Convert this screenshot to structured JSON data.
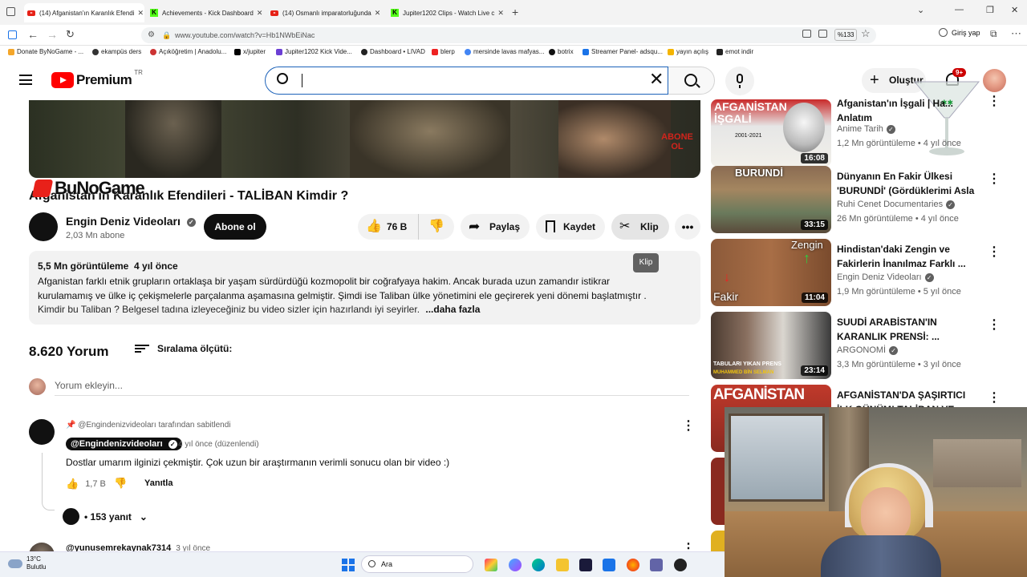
{
  "browser": {
    "tabs": [
      {
        "label": "(14) Afganistan'ın Karanlık Efendi",
        "favicon": "youtube",
        "active": true
      },
      {
        "label": "Achievements - Kick Dashboard",
        "favicon": "kick",
        "active": false
      },
      {
        "label": "(14) Osmanlı imparatorluğunda",
        "favicon": "youtube",
        "active": false
      },
      {
        "label": "Jupiter1202 Clips - Watch Live c",
        "favicon": "kick",
        "active": false
      }
    ],
    "url": "www.youtube.com/watch?v=Hb1NWbEiNac",
    "zoom": "%133",
    "signin_label": "Giriş yap",
    "bookmarks": [
      "Donate ByNoGame - ...",
      "ekampüs ders",
      "Açıköğretim | Anadolu...",
      "x/jupiter",
      "Jupiter1202 Kick Vide...",
      "Dashboard • LIVAD",
      "blerp",
      "mersinde lavas mafyas...",
      "botrix",
      "Streamer Panel- adsqu...",
      "yayın açılış",
      "emot indir"
    ]
  },
  "youtube": {
    "logo_text": "Premium",
    "logo_region": "TR",
    "search_value": "",
    "create_label": "Oluştur",
    "notif_count": "9+"
  },
  "video": {
    "overlay_text": "ABONE OL",
    "watermark": "BuNoGame",
    "title": "Afganistan'ın Karanlık Efendileri - TALİBAN Kimdir ?",
    "channel": "Engin Deniz Videoları",
    "subscribers": "2,03 Mn abone",
    "subscribe_label": "Abone ol",
    "likes": "76 B",
    "share_label": "Paylaş",
    "save_label": "Kaydet",
    "clip_label": "Klip",
    "clip_tooltip": "Klip"
  },
  "description": {
    "meta": "5,5 Mn görüntüleme  4 yıl önce",
    "line1": "Afganistan farklı etnik grupların ortaklaşa bir yaşam sürdürdüğü kozmopolit bir coğrafyaya hakim. Ancak burada uzun zamandır istikrar",
    "line2": "kurulamamış ve ülke iç çekişmelerle parçalanma aşamasına gelmiştir. Şimdi ise Taliban ülke yönetimini ele geçirerek yeni dönemi başlatmıştır .",
    "line3": "Kimdir bu Taliban ? Belgesel tadına izleyeceğiniz bu video sizler için hazırlandı iyi seyirler.",
    "more": "...daha fazla"
  },
  "comments": {
    "count": "8.620 Yorum",
    "sort_label": "Sıralama ölçütü:",
    "add_placeholder": "Yorum ekleyin...",
    "pinned_label": "@Engindenizvideoları tarafından sabitlendi",
    "author": "@Engindenizvideoları",
    "time": "4 yıl önce (düzenlendi)",
    "text": "Dostlar umarım ilginizi çekmiştir. Çok uzun bir araştırmanın verimli sonucu olan bir video :)",
    "likes": "1,7 B",
    "reply_label": "Yanıtla",
    "replies": "• 153 yanıt",
    "next_author": "@yunusemrekaynak7314",
    "next_time": "3 yıl önce"
  },
  "recommendations": [
    {
      "thumb_text": "AFGANİSTAN İŞGALİ",
      "thumb_sub": "2001-2021",
      "duration": "16:08",
      "title": "Afganistan'ın İşgali | Ha... Anlatım",
      "channel": "Anime Tarih",
      "meta": "1,2 Mn görüntüleme • 4 yıl önce"
    },
    {
      "thumb_text": "BURUNDİ",
      "thumb_sub": "",
      "duration": "33:15",
      "title": "Dünyanın En Fakir Ülkesi 'BURUNDİ' (Gördüklerimi Asla ...",
      "channel": "Ruhi Cenet Documentaries",
      "meta": "26 Mn görüntüleme • 4 yıl önce"
    },
    {
      "thumb_text": "Zengin",
      "thumb_sub": "Fakir",
      "duration": "11:04",
      "title": "Hindistan'daki Zengin ve Fakirlerin İnanılmaz Farklı ...",
      "channel": "Engin Deniz Videoları",
      "meta": "1,9 Mn görüntüleme • 5 yıl önce"
    },
    {
      "thumb_text": "TABULARI YIKAN PRENS",
      "thumb_sub": "MUHAMMED BİN SELMAN",
      "duration": "23:14",
      "title": "SUUDİ ARABİSTAN'IN KARANLIK PRENSİ: ...",
      "channel": "ARGONOMİ",
      "meta": "3,3 Mn görüntüleme • 3 yıl önce"
    },
    {
      "thumb_text": "AFGANİSTAN",
      "thumb_sub": "",
      "duration": "",
      "title": "AFGANİSTAN'DA ŞAŞIRTICI İLK GÜNÜM! TALİBAN VE ŞERİAT",
      "channel": "",
      "meta": ""
    }
  ],
  "taskbar": {
    "weather_temp": "13°C",
    "weather_desc": "Bulutlu",
    "search_label": "Ara"
  },
  "colors": {
    "youtube_red": "#ff0000",
    "kick_green": "#53fc18",
    "search_border": "#1c62b9",
    "subscribe_bg": "#0f0f0f"
  }
}
